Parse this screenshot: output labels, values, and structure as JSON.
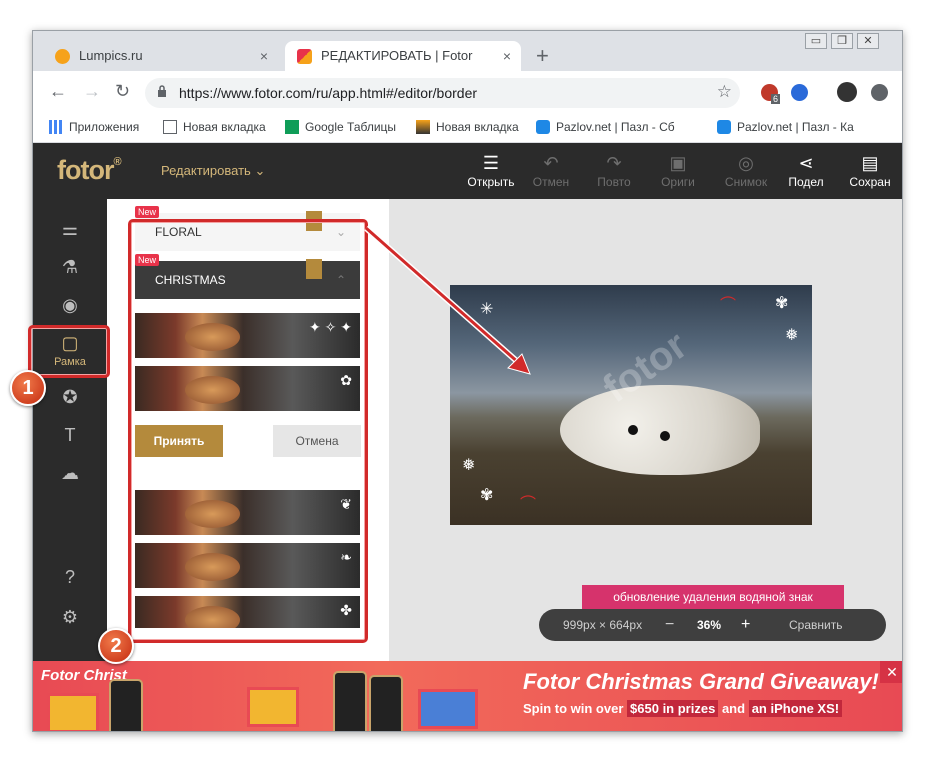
{
  "browser": {
    "tabs": [
      {
        "title": "Lumpics.ru",
        "close": "×"
      },
      {
        "title": "РЕДАКТИРОВАТЬ | Fotor",
        "close": "×"
      }
    ],
    "new_tab": "+",
    "window_controls": {
      "minimize": "▭",
      "restore": "❐",
      "close": "✕"
    },
    "url": "https://www.fotor.com/ru/app.html#/editor/border",
    "extension_badge": "6"
  },
  "bookmarks": [
    {
      "label": "Приложения",
      "icon": "apps-grid-icon"
    },
    {
      "label": "Новая вкладка",
      "icon": "page-icon"
    },
    {
      "label": "Google Таблицы",
      "icon": "sheets-icon"
    },
    {
      "label": "Новая вкладка",
      "icon": "image-icon"
    },
    {
      "label": "Pazlov.net | Пазл - Сб",
      "icon": "puzzle-icon"
    },
    {
      "label": "Pazlov.net | Пазл - Ка",
      "icon": "puzzle-icon"
    }
  ],
  "fotor": {
    "logo": "fotor",
    "logo_mark": "®",
    "edit_menu": "Редактировать",
    "toolbar": [
      {
        "label": "Открыть",
        "icon": "menu-icon",
        "enabled": true
      },
      {
        "label": "Отмен",
        "icon": "undo-icon",
        "enabled": false
      },
      {
        "label": "Повто",
        "icon": "redo-icon",
        "enabled": false
      },
      {
        "label": "Ориги",
        "icon": "original-icon",
        "enabled": false
      },
      {
        "label": "Снимок",
        "icon": "snapshot-icon",
        "enabled": false
      },
      {
        "label": "Подел",
        "icon": "share-icon",
        "enabled": true
      },
      {
        "label": "Сохран",
        "icon": "save-icon",
        "enabled": true
      }
    ],
    "sidebar": {
      "frame_label": "Рамка"
    },
    "panel": {
      "floral": "FLORAL",
      "christmas": "CHRISTMAS",
      "new_badge": "New",
      "accept": "Принять",
      "cancel": "Отмена"
    },
    "canvas": {
      "watermark_text": "fotor",
      "watermark_bar": "обновление удаления водяной знак",
      "dimensions": "999px × 664px",
      "zoom_minus": "−",
      "zoom": "36%",
      "zoom_plus": "+",
      "compare": "Сравнить"
    },
    "ad": {
      "left_title": "Fotor Christ",
      "title": "Fotor Christmas Grand Giveaway!",
      "line_start": "Spin to win over",
      "highlight_1": "$650 in prizes",
      "line_mid": "and",
      "highlight_2": "an iPhone XS!",
      "close": "✕"
    }
  },
  "annotations": {
    "step1": "1",
    "step2": "2"
  },
  "colors": {
    "accent": "#b48a3c",
    "annotation": "#d12a2a",
    "dark": "#2b2b2b"
  }
}
